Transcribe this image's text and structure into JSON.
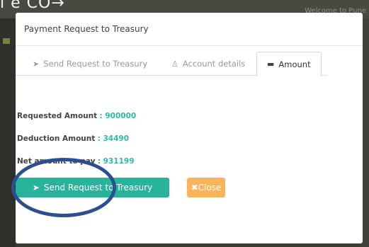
{
  "background": {
    "heading_fragment": "ı е СО→",
    "right_text": "Welcome to Pune"
  },
  "modal": {
    "title": "Payment Request to Treasury",
    "tabs": [
      {
        "label": "Send Request to Treasury",
        "icon": "paper-plane-icon"
      },
      {
        "label": "Account details",
        "icon": "user-icon"
      },
      {
        "label": "Amount",
        "icon": "money-icon"
      }
    ],
    "fields": [
      {
        "label": "Requested Amount",
        "value": ": 900000"
      },
      {
        "label": "Deduction Amount",
        "value": ": 34490"
      },
      {
        "label": "Net amount to pay",
        "value": ": 931199"
      }
    ],
    "send_button": "Send Request to Treasury",
    "close_button": "Close"
  },
  "colors": {
    "primary_button": "#27b49a",
    "close_button": "#fbb45a",
    "value_text": "#2fb9a3",
    "annotation": "#2d4f8f"
  }
}
